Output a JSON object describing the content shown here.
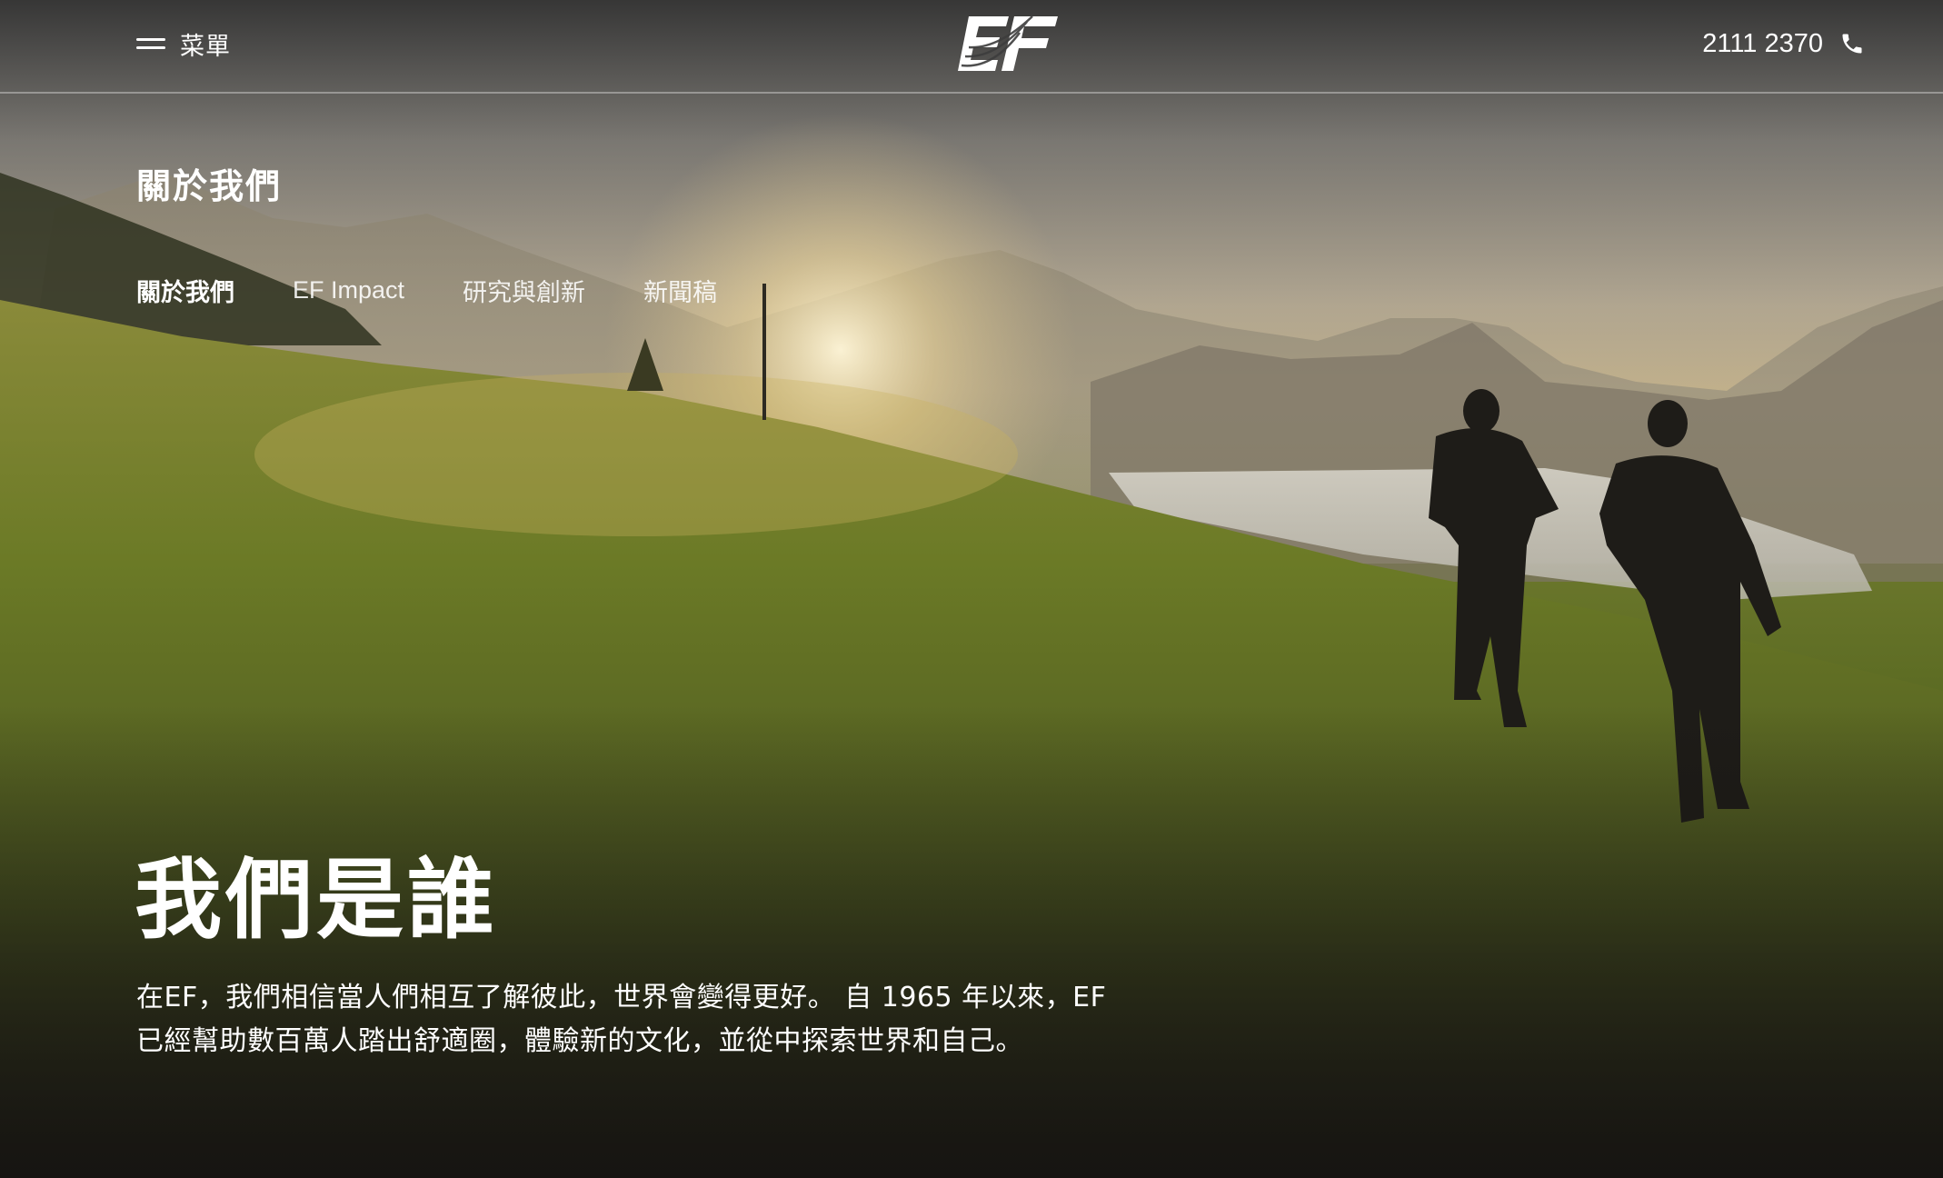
{
  "header": {
    "menu_label": "菜單",
    "logo_text": "EF",
    "phone": "2111 2370"
  },
  "section": {
    "title": "關於我們",
    "tabs": [
      {
        "label": "關於我們",
        "active": true
      },
      {
        "label": "EF Impact",
        "active": false
      },
      {
        "label": "研究與創新",
        "active": false
      },
      {
        "label": "新聞稿",
        "active": false
      }
    ]
  },
  "hero": {
    "title": "我們是誰",
    "body_line1": "在EF，我們相信當人們相互了解彼此，世界會變得更好。 自 1965 年以來，EF",
    "body_line2": "已經幫助數百萬人踏出舒適圈，體驗新的文化，並從中探索世界和自己。"
  },
  "icons": {
    "menu": "hamburger-icon",
    "phone": "phone-icon",
    "logo": "ef-logo"
  },
  "colors": {
    "text": "#ffffff"
  }
}
